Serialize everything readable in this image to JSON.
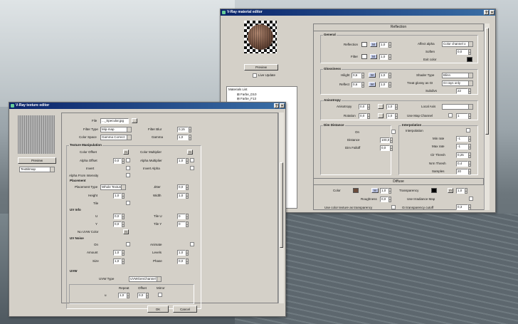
{
  "mat": {
    "title": "V-Ray material editor",
    "preview": "Preview",
    "live_update": "Live Update",
    "materials_list": "Materials List",
    "list_items": [
      "Farbe_D10",
      "Farbe_F13"
    ],
    "reflection_band": "Reflection",
    "diffuse_band": "Diffuse",
    "general": {
      "title": "General",
      "reflection": "Reflection",
      "filter": "Filter",
      "m": "M",
      "v1": "1,0",
      "v2": "1,0",
      "affect_alpha": "Affect alpha",
      "affect_alpha_val": "Color channel o",
      "soften": "Soften",
      "soften_val": "0,0",
      "exit_color": "Exit color"
    },
    "gloss": {
      "title": "Glossiness",
      "hilight": "Hilight",
      "reflect": "Reflect",
      "hv": "0,6",
      "rv": "0,6",
      "one": "1,0",
      "shader_type": "Shader Type",
      "shader_val": "Blinn",
      "treat": "Treat glossy as GI",
      "treat_val": "GI rays only",
      "subdivs": "Subdivs",
      "subdivs_val": "22"
    },
    "aniso": {
      "title": "Anisotropy",
      "anisotropy": "Anisotropy",
      "rotation": "Rotation",
      "v": "0,0",
      "one": "1,0",
      "local_axis": "Local Axis",
      "use_map": "Use Map Channel",
      "map_val": "1"
    },
    "dim": {
      "title": "Dim Distance",
      "on": "On",
      "distance": "Distance",
      "distance_val": "100,0",
      "falloff": "Dim Falloff",
      "falloff_val": "0,0"
    },
    "interp": {
      "title": "Interpolation",
      "interpolation": "Interpolation",
      "min_rate": "Min rate",
      "min_val": "-1",
      "max_rate": "Max rate",
      "max_val": "-1",
      "clr": "Clr Thresh",
      "clr_val": "0,25",
      "nrm": "Nrm Thresh",
      "nrm_val": "0,4",
      "samples": "Samples",
      "samples_val": "20"
    },
    "diffuse": {
      "color": "Color",
      "m": "M",
      "v": "1,0",
      "roughness": "Roughness",
      "rough_val": "0,0",
      "transparency": "Transparency",
      "t_m": "m",
      "t_v": "1,0",
      "use_irr": "Use Irradiance Map",
      "use_color_tex": "Use color texture as transparency",
      "gi_cutoff": "GI transparency cutoff",
      "gi_val": "0,3"
    },
    "colors": {
      "diffuse": "#6b4b3a",
      "transp": "#000000",
      "exit": "#000000"
    }
  },
  "tex": {
    "title": "V-Ray texture editor",
    "preview": "Preview",
    "bitmap": "TexBitmap",
    "file": "File",
    "file_val": "..._Specular.jpg",
    "file_btn": "...",
    "filter_type": "Filter Type",
    "filter_val": "Mip-map",
    "filter_blur": "Filter Blur",
    "blur_val": "0,15",
    "color_space": "Color Space",
    "cs_val": "Gamma Correct",
    "gamma": "Gamma",
    "gamma_val": "1,0",
    "manip": "Texture Manipulation",
    "color_offset": "Color Offset",
    "color_mult": "Color Multiplier",
    "m": "m",
    "alpha_offset": "Alpha Offset",
    "ao_val": "0,0",
    "alpha_mult": "Alpha Multiplier",
    "am_val": "1,0",
    "invert": "Invert",
    "invert_alpha": "Invert Alpha",
    "alpha_from_int": "Alpha From Intensity",
    "placement": "Placement",
    "placement_type": "Placement Type",
    "pt_val": "Whole Texture",
    "jitter": "Jitter",
    "jitter_val": "0,0",
    "height": "Height",
    "height_val": "1,0",
    "width": "Width",
    "width_val": "1,0",
    "tile": "Tile",
    "uv_info": "UV Info",
    "u": "U",
    "y": "Y",
    "u_val": "0,0",
    "y_val": "0,0",
    "tile_u": "Tile U",
    "tile_y": "Tile Y",
    "tu_val": "0",
    "ty_val": "0",
    "no_uvw": "No UVW Color",
    "uv_noise": "UV Noise",
    "on": "On",
    "animate": "Animate",
    "amount": "Amount",
    "amount_val": "1,0",
    "levels": "Levels",
    "levels_val": "1,0",
    "size": "Size",
    "size_val": "1,0",
    "phase": "Phase",
    "phase_val": "0,0",
    "uvw": "UVW",
    "uvw_type": "UVW Type",
    "uvw_val": "UVWGenChannel",
    "repeat": "Repeat",
    "offset": "Offset",
    "mirror": "Mirror",
    "uv_u": "u",
    "rep_val": "1,0",
    "off_val": "0,0",
    "ok": "OK",
    "cancel": "Cancel"
  }
}
